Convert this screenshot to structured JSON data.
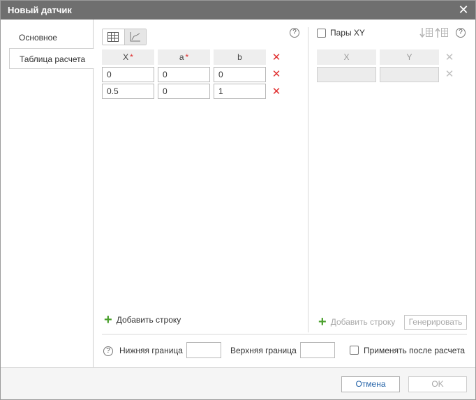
{
  "window": {
    "title": "Новый датчик"
  },
  "tabs": [
    {
      "label": "Основное"
    },
    {
      "label": "Таблица расчета"
    }
  ],
  "left_table": {
    "columns": [
      {
        "label": "X",
        "required": "*"
      },
      {
        "label": "a",
        "required": "*"
      },
      {
        "label": "b",
        "required": ""
      }
    ],
    "rows": [
      [
        "0",
        "0",
        "0"
      ],
      [
        "0.5",
        "0",
        "1"
      ]
    ],
    "add_row_label": "Добавить строку"
  },
  "xy_pairs": {
    "checkbox_label": "Пары XY",
    "columns": [
      "X",
      "Y"
    ],
    "add_row_label": "Добавить строку",
    "generate_label": "Генерировать"
  },
  "bounds": {
    "lower_label": "Нижняя граница",
    "upper_label": "Верхняя граница",
    "lower_value": "",
    "upper_value": "",
    "apply_after_label": "Применять после расчета"
  },
  "footer": {
    "cancel_label": "Отмена",
    "ok_label": "OK"
  },
  "icons": {
    "help": "?",
    "close": "✕",
    "delete": "✕",
    "add": "+"
  },
  "colors": {
    "titlebar": "#6f6f6f",
    "required": "#e03030",
    "add_green": "#4aa02c",
    "link_blue": "#2463a8"
  }
}
